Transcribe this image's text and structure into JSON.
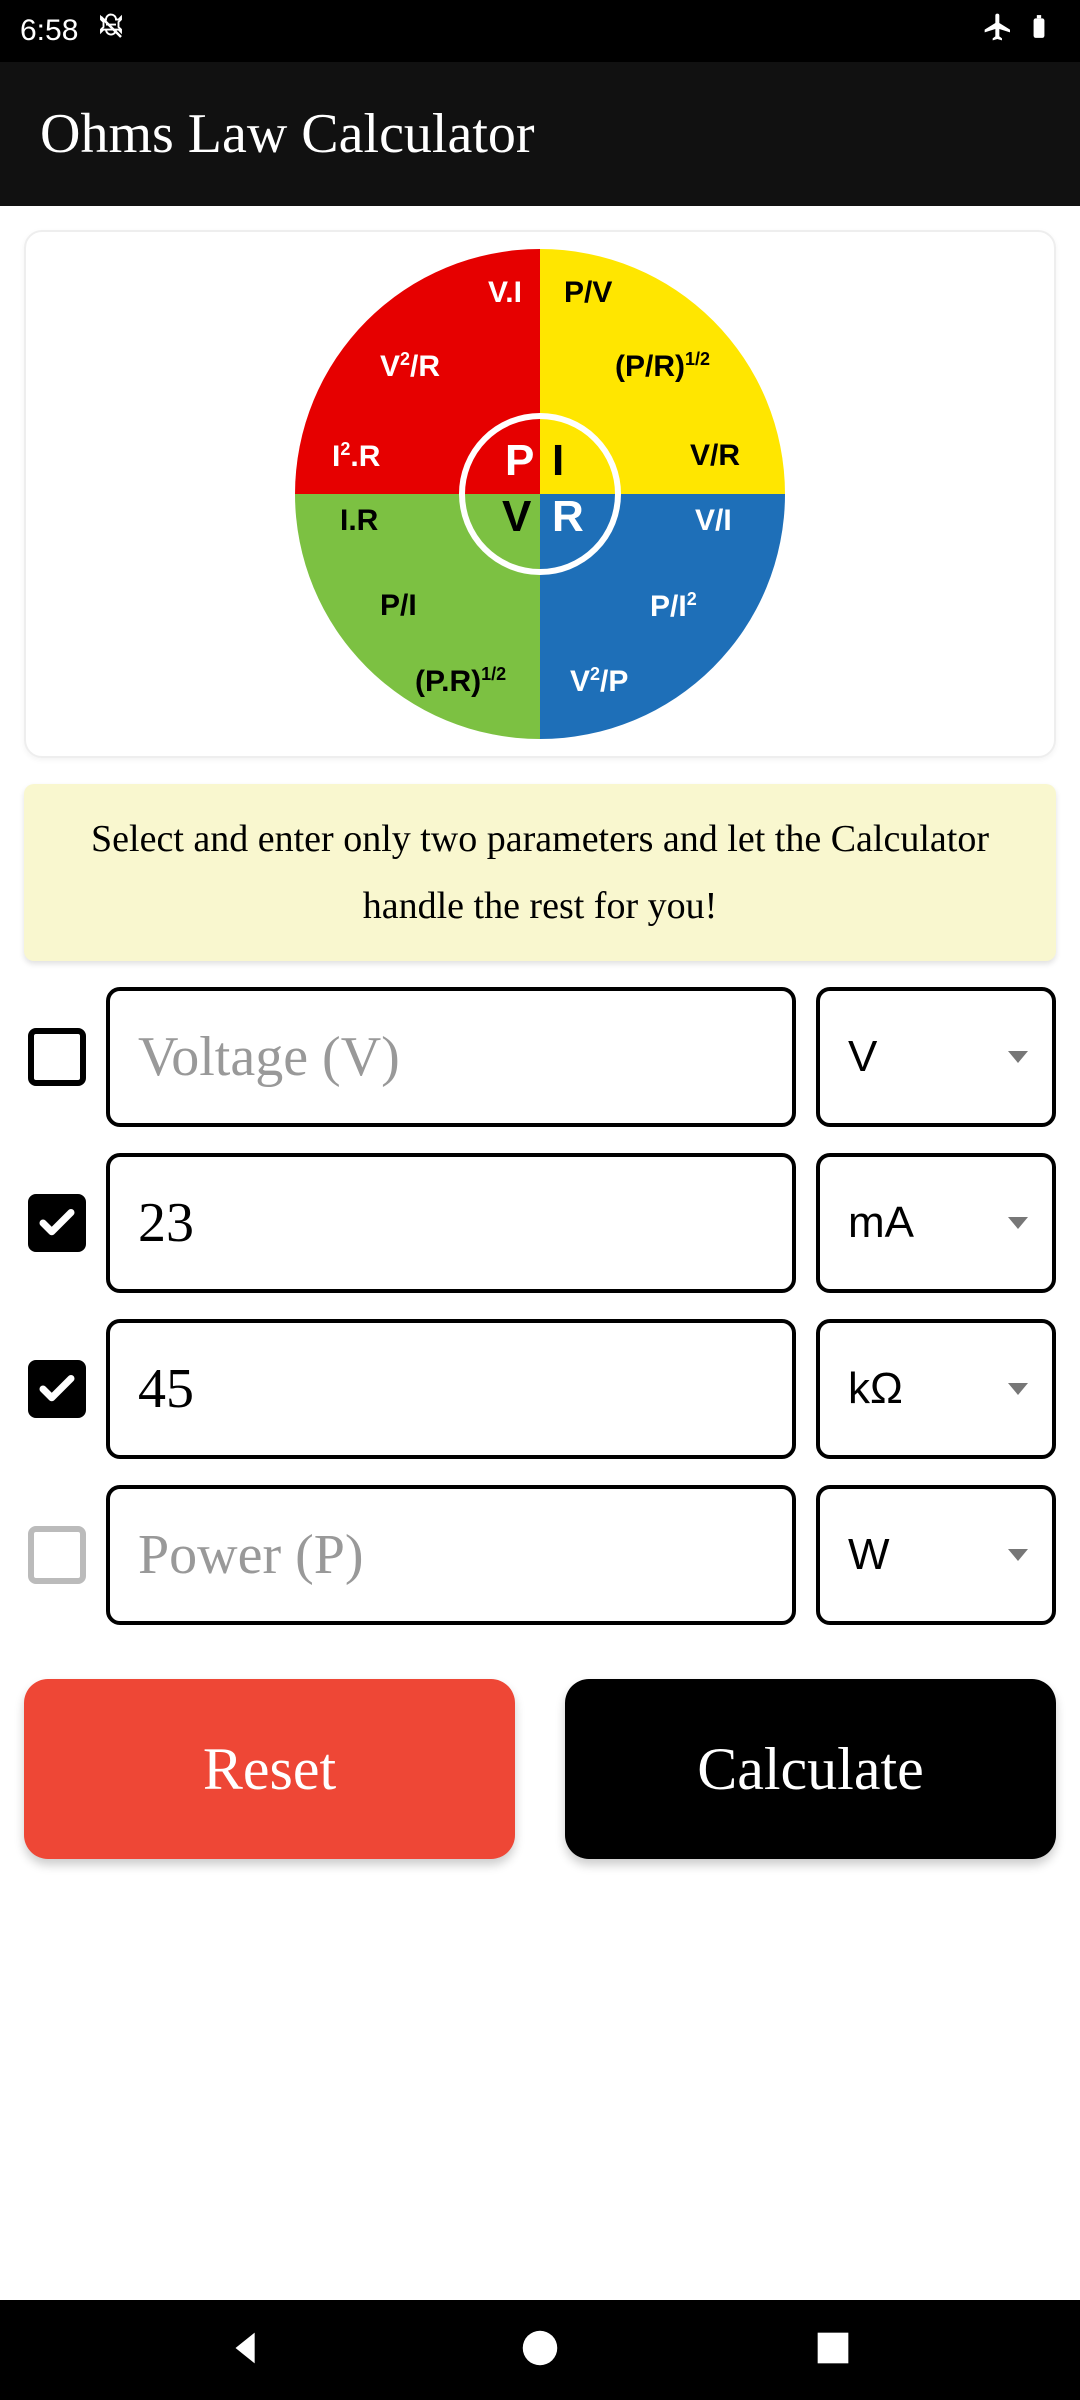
{
  "status": {
    "time": "6:58"
  },
  "app": {
    "title": "Ohms Law Calculator"
  },
  "wheel": {
    "center": {
      "p": "P",
      "i": "I",
      "v": "V",
      "r": "R"
    },
    "formulas": {
      "red1": "V.I",
      "red2": "V²/R",
      "red3": "I².R",
      "yellow1": "P/V",
      "yellow2": "(P/R)¹/²",
      "yellow3": "V/R",
      "green1": "I.R",
      "green2": "P/I",
      "green3": "(P.R)¹/²",
      "blue1": "V/I",
      "blue2": "P/I²",
      "blue3": "V²/P"
    }
  },
  "hint": "Select and enter only two parameters and let the Calculator handle the rest for you!",
  "rows": {
    "voltage": {
      "checked": false,
      "value": "",
      "placeholder": "Voltage (V)",
      "unit": "V",
      "disabled": false
    },
    "current": {
      "checked": true,
      "value": "23",
      "placeholder": "",
      "unit": "mA",
      "disabled": false
    },
    "resistance": {
      "checked": true,
      "value": "45",
      "placeholder": "",
      "unit": "kΩ",
      "disabled": false
    },
    "power": {
      "checked": false,
      "value": "",
      "placeholder": "Power (P)",
      "unit": "W",
      "disabled": true
    }
  },
  "buttons": {
    "reset": "Reset",
    "calculate": "Calculate"
  }
}
